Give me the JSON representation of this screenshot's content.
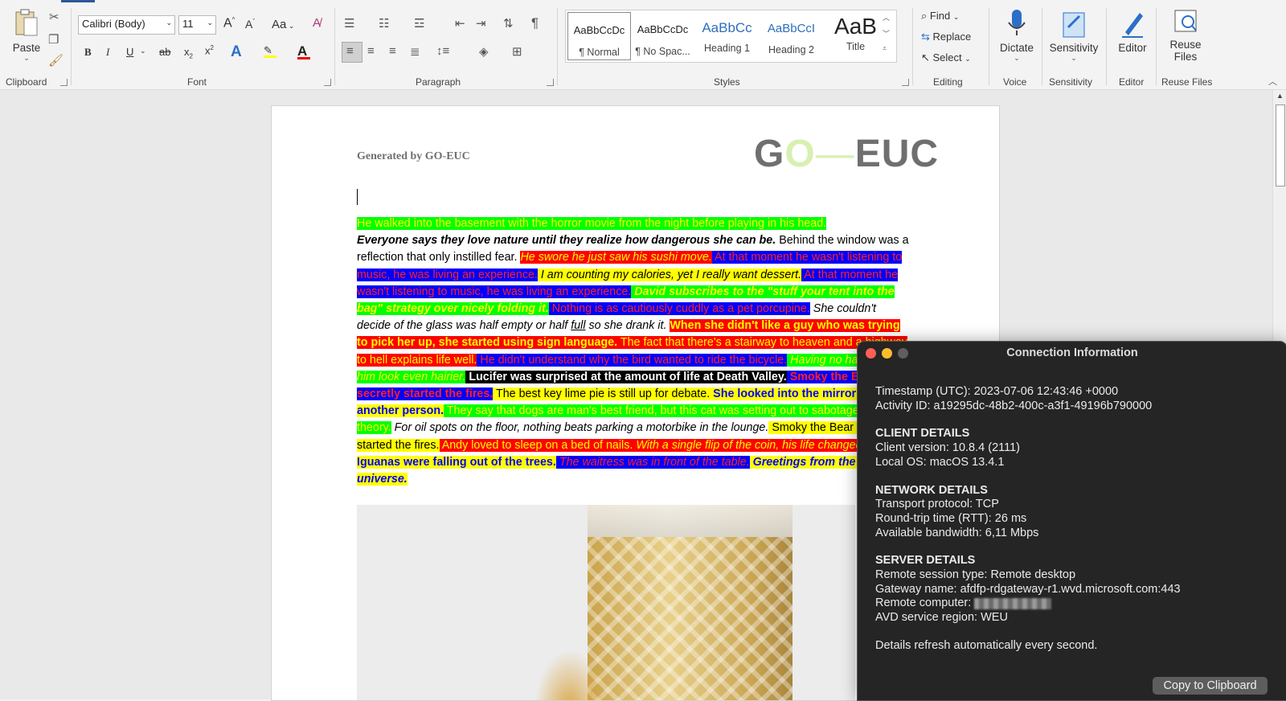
{
  "ribbon": {
    "clipboard": {
      "paste_label": "Paste",
      "group_label": "Clipboard"
    },
    "font": {
      "font_name": "Calibri (Body)",
      "font_size": "11",
      "group_label": "Font",
      "change_case": "Aa"
    },
    "paragraph": {
      "group_label": "Paragraph"
    },
    "styles": {
      "group_label": "Styles",
      "items": [
        {
          "sample": "AaBbCcDc",
          "name": "¶ Normal"
        },
        {
          "sample": "AaBbCcDc",
          "name": "¶ No Spac..."
        },
        {
          "sample": "AaBbCc",
          "name": "Heading 1"
        },
        {
          "sample": "AaBbCcI",
          "name": "Heading 2"
        },
        {
          "sample": "AaB",
          "name": "Title"
        }
      ]
    },
    "editing": {
      "find": "Find",
      "replace": "Replace",
      "select": "Select",
      "group_label": "Editing"
    },
    "voice": {
      "dictate": "Dictate",
      "group_label": "Voice"
    },
    "sensitivity": {
      "label": "Sensitivity",
      "group_label": "Sensitivity"
    },
    "editor": {
      "label": "Editor",
      "group_label": "Editor"
    },
    "reuse": {
      "label_line1": "Reuse",
      "label_line2": "Files",
      "group_label": "Reuse Files"
    }
  },
  "document": {
    "header_text": "Generated by GO-EUC",
    "logo": {
      "g": "G",
      "o": "O",
      "dash": "—",
      "euc": "EUC"
    },
    "segments": [
      {
        "text": "He walked into the basement with the horror movie from the night before playing in his head.",
        "cls": "g ty"
      },
      {
        "text": "Everyone says they love nature until they realize how dangerous she can be.",
        "cls": "it bd"
      },
      {
        "text": " Behind the window was a reflection that only instilled fear. ",
        "cls": ""
      },
      {
        "text": "He swore he just saw his sushi move.",
        "cls": "r ty it"
      },
      {
        "text": " At that moment he wasn't listening to music, he was living an experience.",
        "cls": "b tr"
      },
      {
        "text": " I am counting my calories, yet I really want dessert.",
        "cls": "y it"
      },
      {
        "text": " At that moment he wasn't listening to music, he was living an experience.",
        "cls": "b tr"
      },
      {
        "text": " David subscribes to the \"stuff your tent into the bag\" strategy over nicely folding it.",
        "cls": "g ty it bd"
      },
      {
        "text": " Nothing is as cautiously cuddly as a pet porcupine.",
        "cls": "b tr"
      },
      {
        "text": " She couldn't decide of the glass was half empty or half ",
        "cls": "it"
      },
      {
        "text": "full",
        "cls": "it ul"
      },
      {
        "text": " so she drank it. ",
        "cls": "it"
      },
      {
        "text": "When she didn't like a guy who was trying to pick her up, she started using sign language.",
        "cls": "r ty bd"
      },
      {
        "text": " The fact that there's a stairway to heaven and a highway to hell explains life well.",
        "cls": "r ty"
      },
      {
        "text": " He didn't understand why the bird wanted to ride the bicycle.",
        "cls": "b tr"
      },
      {
        "text": " Having no hair made him look even hairier.",
        "cls": "g ty it"
      },
      {
        "text": " Lucifer was surprised at the amount of life at Death Valley.",
        "cls": "k bd"
      },
      {
        "text": " Smoky the Bear secretly started the fires.",
        "cls": "b tr bd"
      },
      {
        "text": " The best key lime pie is still up for debate.",
        "cls": "y"
      },
      {
        "text": " She looked into the mirror and saw another person.",
        "cls": "y tb bd"
      },
      {
        "text": " They say that dogs are man's best friend, but this cat was setting out to sabotage that theory.",
        "cls": "g ty"
      },
      {
        "text": " For oil spots on the floor, nothing beats parking a motorbike in the lounge.",
        "cls": "it"
      },
      {
        "text": " Smoky the Bear secretly started the fires.",
        "cls": "y"
      },
      {
        "text": " Andy loved to sleep on a bed of nails.",
        "cls": "r ty"
      },
      {
        "text": " With a single flip of the coin, his life changed forever.",
        "cls": "r ty it"
      },
      {
        "text": " Iguanas were falling out of the trees.",
        "cls": "y tb bd"
      },
      {
        "text": " The waitress was in front of the table.",
        "cls": "b tr it"
      },
      {
        "text": " Greetings from the real universe.",
        "cls": "y tb it bd"
      }
    ]
  },
  "dialog": {
    "title": "Connection Information",
    "timestamp": "Timestamp (UTC): 2023-07-06 12:43:46 +0000",
    "activity": "Activity ID: a19295dc-48b2-400c-a3f1-49196b790000",
    "client_header": "CLIENT DETAILS",
    "client_version": "Client version: 10.8.4 (2111)",
    "local_os": "Local OS: macOS 13.4.1",
    "network_header": "NETWORK DETAILS",
    "transport": "Transport protocol: TCP",
    "rtt": "Round-trip time (RTT): 26 ms",
    "bandwidth": "Available bandwidth: 6,11 Mbps",
    "server_header": "SERVER DETAILS",
    "session_type": "Remote session type: Remote desktop",
    "gateway": "Gateway name: afdfp-rdgateway-r1.wvd.microsoft.com:443",
    "remote_computer_label": "Remote computer: ",
    "region": "AVD service region: WEU",
    "refresh_note": "Details refresh automatically every second.",
    "copy_button": "Copy to Clipboard",
    "colors": {
      "close": "#ff5f57",
      "minimize": "#febc2e",
      "zoom": "#5f5f5f"
    }
  }
}
